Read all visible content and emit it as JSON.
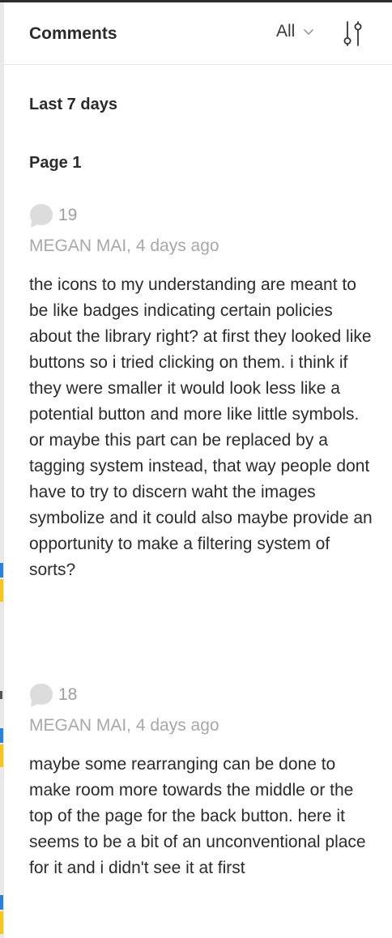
{
  "panel": {
    "title": "Comments",
    "filter_value": "All",
    "filter_icon": "chevron-down-icon",
    "settings_icon": "sliders-icon"
  },
  "sections": {
    "period_label": "Last 7 days",
    "page_label": "Page 1"
  },
  "comments": [
    {
      "reply_number": "19",
      "byline": "MEGAN MAI, 4 days ago",
      "body": "the icons to my understanding are meant to be like badges indicating certain policies about the library right? at first they looked like buttons so i tried clicking on them. i think if they were smaller it would look less like a potential button and more like little symbols. or maybe this part can be replaced by a tagging system instead, that way people dont have to try to discern waht the images symbolize and it could also maybe provide an opportunity to make a filtering system of sorts?"
    },
    {
      "reply_number": "18",
      "byline": "MEGAN MAI, 4 days ago",
      "body": "maybe some rearranging can be done to make room more towards the middle or the top of the page for the back button. here it seems to be a bit of an unconventional place for it and i didn't see it at first"
    }
  ],
  "colors": {
    "text": "#2b2b2b",
    "muted": "#a8a8a8",
    "bubble": "#dcdcdc",
    "divider": "#e5e5e5",
    "rail_blue": "#2f7fd6",
    "rail_yellow": "#f3c623"
  }
}
